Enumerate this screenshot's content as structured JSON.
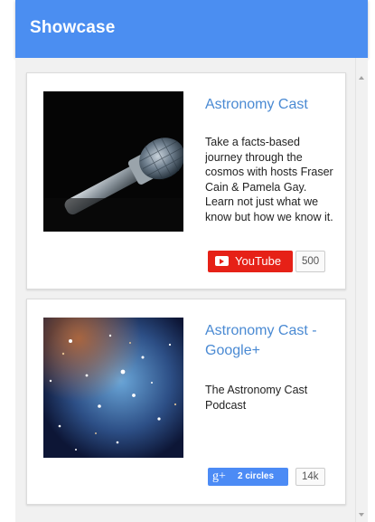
{
  "header": {
    "title": "Showcase"
  },
  "cards": [
    {
      "title": "Astronomy Cast",
      "description": "Take a facts-based journey through the cosmos with hosts Fraser Cain & Pamela Gay. Learn not just what we know but how we know it.",
      "button_label": "YouTube",
      "count": "500",
      "image": "microphone-image"
    },
    {
      "title": "Astronomy Cast - Google+",
      "description": "The Astronomy Cast Podcast",
      "button_label": "2 circles",
      "button_icon": "g+",
      "count": "14k",
      "image": "galaxy-image"
    }
  ],
  "colors": {
    "header": "#4b8ef1",
    "title_link": "#4a8ad3",
    "youtube": "#e62117",
    "google_plus": "#4c8bf5"
  }
}
